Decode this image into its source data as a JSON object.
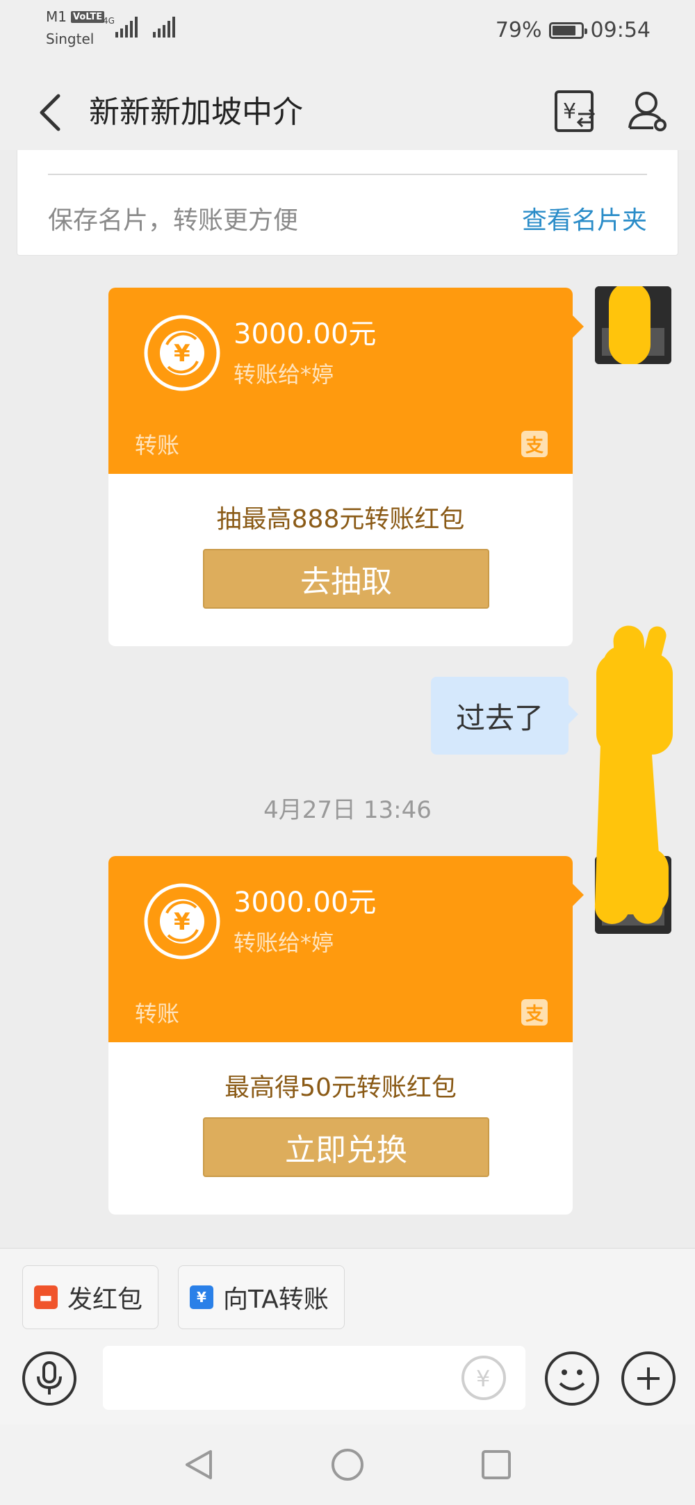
{
  "status_bar": {
    "carrier1": "M1",
    "volte": "VoLTE",
    "carrier2": "Singtel",
    "net": "4G",
    "battery": "79%",
    "time": "09:54"
  },
  "header": {
    "title": "新新新加坡中介",
    "icons": [
      "back-icon",
      "transfer-record-icon",
      "person-settings-icon"
    ]
  },
  "namecard": {
    "text": "保存名片，转账更方便",
    "link": "查看名片夹"
  },
  "messages": [
    {
      "type": "transfer",
      "amount": "3000.00元",
      "to": "转账给*婷",
      "label": "转账",
      "brand_glyph": "支",
      "promo_text": "抽最高888元转账红包",
      "promo_button": "去抽取"
    },
    {
      "type": "text",
      "text": "过去了"
    },
    {
      "type": "timestamp",
      "text": "4月27日 13:46"
    },
    {
      "type": "transfer",
      "amount": "3000.00元",
      "to": "转账给*婷",
      "label": "转账",
      "brand_glyph": "支",
      "promo_text": "最高得50元转账红包",
      "promo_button": "立即兑换"
    }
  ],
  "toolbar": {
    "red_packet": "发红包",
    "transfer_to": "向TA转账"
  },
  "colors": {
    "transfer_orange": "#ff9a0e",
    "promo_button": "#ddad5c",
    "link_blue": "#2a8cc8",
    "text_bubble": "#d5e8fc",
    "scribble_yellow": "#ffc40c"
  }
}
